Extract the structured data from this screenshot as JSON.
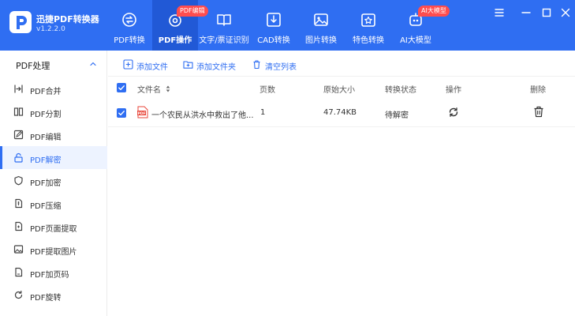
{
  "app": {
    "name": "迅捷PDF转换器",
    "version": "v1.2.2.0"
  },
  "nav": {
    "tabs": [
      {
        "label": "PDF转换",
        "icon": "pdf-convert-icon"
      },
      {
        "label": "PDF操作",
        "icon": "pdf-operate-icon",
        "badge": "PDF编辑",
        "active": true
      },
      {
        "label": "文字/票证识别",
        "icon": "ocr-icon"
      },
      {
        "label": "CAD转换",
        "icon": "cad-icon"
      },
      {
        "label": "图片转换",
        "icon": "image-icon"
      },
      {
        "label": "特色转换",
        "icon": "special-icon"
      },
      {
        "label": "AI大模型",
        "icon": "ai-icon",
        "badge": "AI大模型"
      }
    ]
  },
  "window_controls": [
    "menu-icon",
    "minimize-icon",
    "maximize-icon",
    "close-icon"
  ],
  "sidebar": {
    "title": "PDF处理",
    "items": [
      {
        "label": "PDF合并",
        "icon": "merge-icon"
      },
      {
        "label": "PDF分割",
        "icon": "split-icon"
      },
      {
        "label": "PDF编辑",
        "icon": "edit-icon"
      },
      {
        "label": "PDF解密",
        "icon": "unlock-icon",
        "active": true
      },
      {
        "label": "PDF加密",
        "icon": "shield-icon"
      },
      {
        "label": "PDF压缩",
        "icon": "compress-icon"
      },
      {
        "label": "PDF页面提取",
        "icon": "page-extract-icon"
      },
      {
        "label": "PDF提取图片",
        "icon": "image-extract-icon"
      },
      {
        "label": "PDF加页码",
        "icon": "page-number-icon"
      },
      {
        "label": "PDF旋转",
        "icon": "rotate-icon"
      }
    ]
  },
  "toolbar": {
    "add_file": "添加文件",
    "add_folder": "添加文件夹",
    "clear_list": "清空列表"
  },
  "table": {
    "headers": {
      "filename": "文件名",
      "pages": "页数",
      "size": "原始大小",
      "status": "转换状态",
      "action": "操作",
      "delete": "删除"
    },
    "rows": [
      {
        "filename": "一个农民从洪水中救出了他...",
        "pages": "1",
        "size": "47.74KB",
        "status": "待解密"
      }
    ]
  },
  "colors": {
    "primary": "#2f6ef2",
    "primary_dark": "#2159d6",
    "badge": "#ff4d4f",
    "pdf_file": "#e8473b"
  }
}
